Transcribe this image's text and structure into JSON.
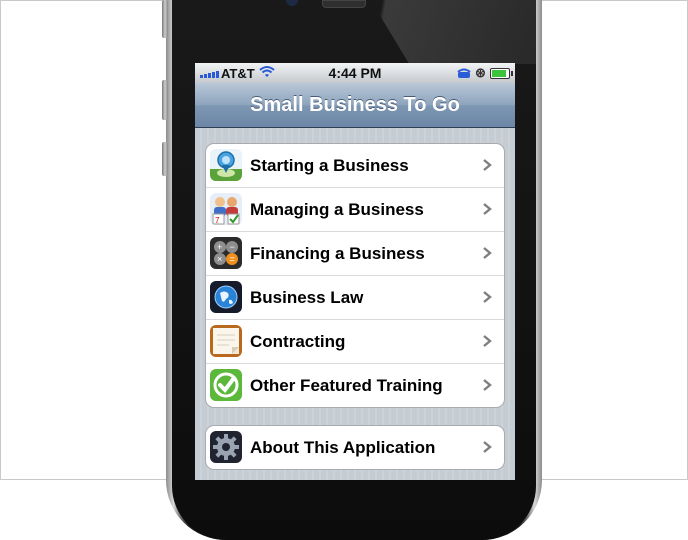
{
  "status_bar": {
    "carrier": "AT&T",
    "time": "4:44 PM",
    "signal_bars": 5,
    "battery_level": 0.9
  },
  "nav": {
    "title": "Small Business To Go"
  },
  "menu": {
    "items": [
      {
        "label": "Starting a Business",
        "icon": "map-pin-icon"
      },
      {
        "label": "Managing a Business",
        "icon": "people-calendar-icon"
      },
      {
        "label": "Financing a Business",
        "icon": "calculator-icon"
      },
      {
        "label": "Business Law",
        "icon": "globe-icon"
      },
      {
        "label": "Contracting",
        "icon": "notepad-icon"
      },
      {
        "label": "Other Featured Training",
        "icon": "checkmark-icon"
      }
    ]
  },
  "about": {
    "label": "About This Application",
    "icon": "gear-icon"
  },
  "colors": {
    "nav_bar": "#7e97b3",
    "background": "#c5ccd4",
    "battery": "#3cc43c"
  }
}
